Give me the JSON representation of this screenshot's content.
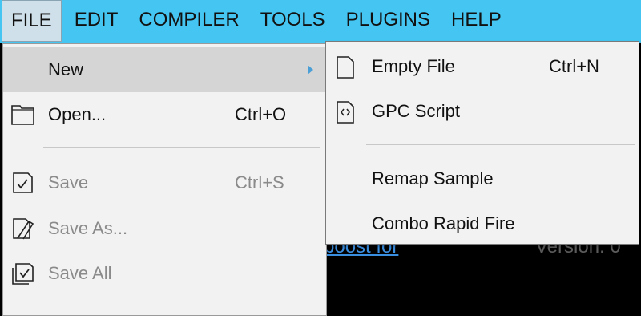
{
  "menubar": {
    "items": [
      "FILE",
      "EDIT",
      "COMPILER",
      "TOOLS",
      "PLUGINS",
      "HELP"
    ]
  },
  "background": {
    "link_text": "boost for",
    "version_text": "Version: 0"
  },
  "file_menu": {
    "new_label": "New",
    "open_label": "Open...",
    "open_shortcut": "Ctrl+O",
    "save_label": "Save",
    "save_shortcut": "Ctrl+S",
    "save_as_label": "Save As...",
    "save_all_label": "Save All"
  },
  "new_submenu": {
    "empty_file_label": "Empty File",
    "empty_file_shortcut": "Ctrl+N",
    "gpc_script_label": "GPC Script",
    "remap_sample_label": "Remap Sample",
    "combo_rapid_fire_label": "Combo Rapid Fire"
  },
  "colors": {
    "menubar": "#45c6f2",
    "menu_bg": "#f2f2f2",
    "highlight": "#d5d5d5",
    "disabled_text": "#8a8a8a"
  },
  "icons": {
    "open": "folder-icon",
    "save": "save-icon",
    "save_as": "save-as-icon",
    "save_all": "save-all-icon",
    "empty_file": "file-icon",
    "gpc_script": "code-file-icon"
  }
}
